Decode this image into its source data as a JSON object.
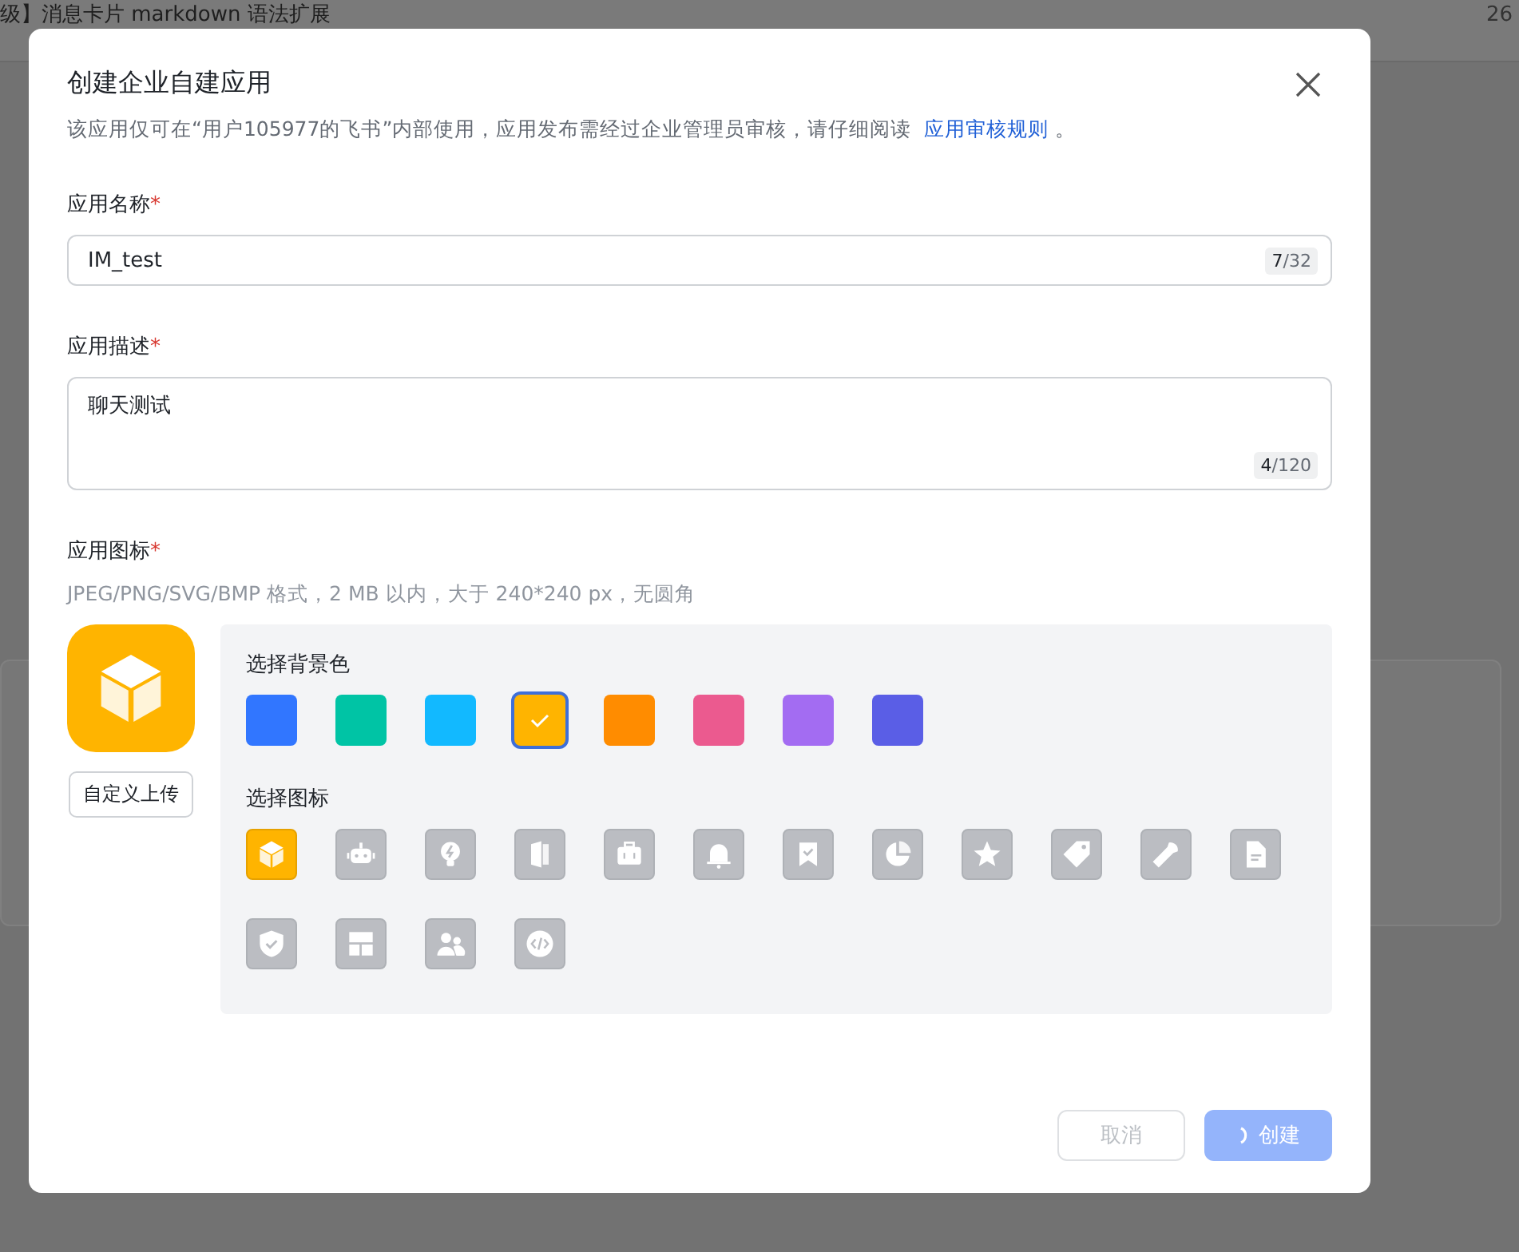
{
  "background": {
    "title": "级】消息卡片 markdown 语法扩展",
    "number": "26"
  },
  "dialog": {
    "title": "创建企业自建应用",
    "notice": {
      "text": "该应用仅可在“用户105977的飞书”内部使用，应用发布需经过企业管理员审核，请仔细阅读",
      "link": "应用审核规则",
      "end": "。"
    },
    "name_field": {
      "label": "应用名称",
      "required_mark": "*",
      "value": "IM_test",
      "count": "7",
      "max": "/32"
    },
    "description_field": {
      "label": "应用描述",
      "required_mark": "*",
      "value": "聊天测试",
      "count": "4",
      "max": "/120"
    },
    "icon_field": {
      "label": "应用图标",
      "required_mark": "*",
      "hint": "JPEG/PNG/SVG/BMP 格式，2 MB 以内，大于 240*240 px，无圆角",
      "upload": "自定义上传",
      "color_label": "选择背景色",
      "colors": [
        {
          "color": "#3176ff",
          "selected": false
        },
        {
          "color": "#00c4a5",
          "selected": false
        },
        {
          "color": "#12b9ff",
          "selected": false
        },
        {
          "color": "#ffb400",
          "selected": true
        },
        {
          "color": "#ff8c00",
          "selected": false
        },
        {
          "color": "#eb5a8f",
          "selected": false
        },
        {
          "color": "#a36cf2",
          "selected": false
        },
        {
          "color": "#5a5ee6",
          "selected": false
        }
      ],
      "icon_label": "选择图标",
      "icons": [
        {
          "kind": "cube",
          "selected": true
        },
        {
          "kind": "robot",
          "selected": false
        },
        {
          "kind": "bulb",
          "selected": false
        },
        {
          "kind": "door",
          "selected": false
        },
        {
          "kind": "briefcase",
          "selected": false
        },
        {
          "kind": "bell",
          "selected": false
        },
        {
          "kind": "bookmark",
          "selected": false
        },
        {
          "kind": "pie",
          "selected": false
        },
        {
          "kind": "star",
          "selected": false
        },
        {
          "kind": "tag",
          "selected": false
        },
        {
          "kind": "wrench",
          "selected": false
        },
        {
          "kind": "document",
          "selected": false
        },
        {
          "kind": "shield",
          "selected": false
        },
        {
          "kind": "layout",
          "selected": false
        },
        {
          "kind": "people",
          "selected": false
        },
        {
          "kind": "code",
          "selected": false
        }
      ]
    },
    "buttons": [
      {
        "kind": "cancel",
        "label": "取消",
        "disabled": true,
        "loading": false
      },
      {
        "kind": "create",
        "label": "创建",
        "disabled": false,
        "loading": true
      }
    ]
  }
}
